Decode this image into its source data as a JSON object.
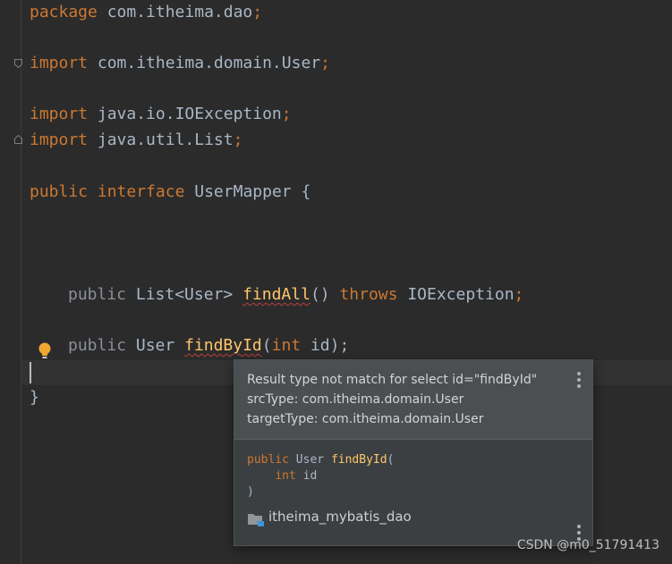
{
  "code": {
    "line1": {
      "kw": "package",
      "rest": " com.itheima.dao",
      "semi": ";"
    },
    "line2": {
      "kw": "import",
      "rest": " com.itheima.domain.User",
      "semi": ";"
    },
    "line3": {
      "kw": "import",
      "rest": " java.io.IOException",
      "semi": ";"
    },
    "line4": {
      "kw": "import",
      "rest": " java.util.List",
      "semi": ";"
    },
    "line5": {
      "kw1": "public",
      "kw2": "interface",
      "rest": " UserMapper {"
    },
    "line6": {
      "kw": "public",
      "type": " List<User> ",
      "method": "findAll",
      "params": "() ",
      "throws": "throws",
      "exc": " IOException",
      "semi": ";"
    },
    "line7": {
      "kw": "public",
      "type": " User ",
      "method": "findById",
      "open": "(",
      "ptype": "int",
      "pname": " id);"
    },
    "line8": {
      "brace": "}"
    }
  },
  "popup": {
    "message_line1": "Result type not match for select id=\"findById\"",
    "message_line2": "srcType: com.itheima.domain.User",
    "message_line3": "targetType: com.itheima.domain.User",
    "signature": {
      "kw": "public",
      "type": " User ",
      "method": "findById",
      "open": "(",
      "ptype": "int",
      "pname": " id",
      "close": ")"
    },
    "module_name": "itheima_mybatis_dao"
  },
  "icons": {
    "fold": "fold-marker-icon",
    "bulb": "intention-bulb-icon",
    "folder": "module-folder-icon",
    "more": "more-vertical-icon"
  },
  "colors": {
    "background": "#2b2b2b",
    "keyword": "#cc7832",
    "method": "#ffc66d",
    "text": "#a9b7c6",
    "error_underline": "#bc3f3c",
    "bulb": "#f0a732"
  },
  "watermark": "CSDN @m0_51791413"
}
